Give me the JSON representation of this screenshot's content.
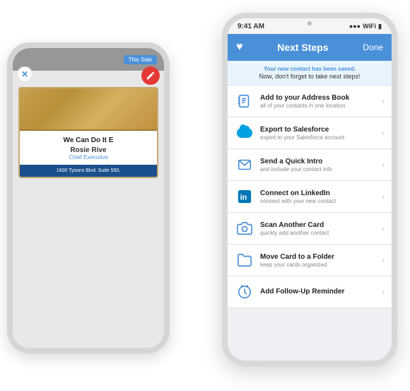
{
  "front_phone": {
    "time": "9:41 AM",
    "signal": "●●●○○",
    "nav": {
      "title": "Next Steps",
      "done_label": "Done"
    },
    "banner": {
      "line1": "Your new contact has been saved.",
      "line2": "Now, don't forget to take next steps!"
    },
    "items": [
      {
        "id": "address-book",
        "title": "Add to your Address Book",
        "subtitle": "all of your contacts in one location",
        "icon": "address-book-icon"
      },
      {
        "id": "salesforce",
        "title": "Export to Salesforce",
        "subtitle": "export to your Salesforce account",
        "icon": "salesforce-icon"
      },
      {
        "id": "quick-intro",
        "title": "Send a Quick Intro",
        "subtitle": "and include your contact info",
        "icon": "send-icon"
      },
      {
        "id": "linkedin",
        "title": "Connect on LinkedIn",
        "subtitle": "connect with your new contact",
        "icon": "linkedin-icon"
      },
      {
        "id": "scan-card",
        "title": "Scan Another Card",
        "subtitle": "quickly add another contact",
        "icon": "camera-icon"
      },
      {
        "id": "move-folder",
        "title": "Move Card to a Folder",
        "subtitle": "keep your cards organized",
        "icon": "folder-icon"
      },
      {
        "id": "followup",
        "title": "Add Follow-Up Reminder",
        "subtitle": "",
        "icon": "reminder-icon"
      }
    ]
  },
  "back_phone": {
    "top_bar_label": "This Side",
    "card": {
      "company": "We Can Do It E",
      "name": "Rosie Rive",
      "title": "Chief Executive",
      "address": "1600 Tysons Blvd. Suite 550,"
    }
  }
}
